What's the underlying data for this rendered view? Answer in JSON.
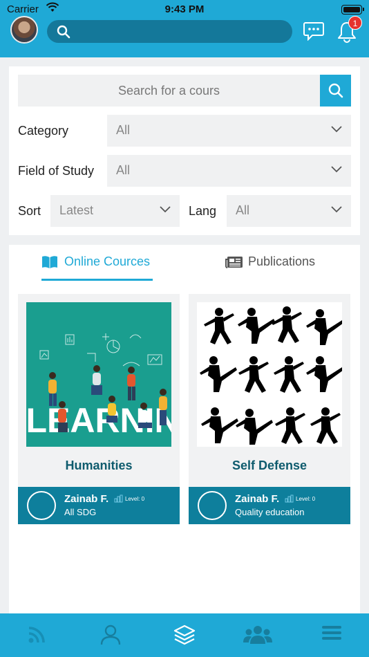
{
  "status_bar": {
    "carrier": "Carrier",
    "time": "9:43 PM"
  },
  "header": {
    "search_placeholder": "",
    "notification_count": "1"
  },
  "filters": {
    "course_search_placeholder": "Search for a cours",
    "category": {
      "label": "Category",
      "value": "All"
    },
    "field_of_study": {
      "label": "Field of Study",
      "value": "All"
    },
    "sort": {
      "label": "Sort",
      "value": "Latest"
    },
    "lang": {
      "label": "Lang",
      "value": "All"
    }
  },
  "tabs": [
    {
      "label": "Online Cources",
      "active": true,
      "icon": "book-icon"
    },
    {
      "label": "Publications",
      "active": false,
      "icon": "newspaper-icon"
    }
  ],
  "courses": [
    {
      "title": "Humanities",
      "image_icon": "elearning-illustration",
      "image_text": "E-LEARNING",
      "author": "Zainab F.",
      "level": "Level: 0",
      "subtitle": "All SDG"
    },
    {
      "title": "Self Defense",
      "image_icon": "martial-arts-silhouettes",
      "author": "Zainab F.",
      "level": "Level: 0",
      "subtitle": "Quality education"
    }
  ],
  "bottom_nav": [
    {
      "name": "feed",
      "icon": "rss-icon"
    },
    {
      "name": "profile",
      "icon": "user-icon"
    },
    {
      "name": "courses",
      "icon": "layers-icon"
    },
    {
      "name": "groups",
      "icon": "users-icon"
    },
    {
      "name": "menu",
      "icon": "menu-icon"
    }
  ],
  "colors": {
    "primary": "#1fa9d6",
    "dark_teal": "#0e7f9c",
    "title": "#0e5b6d",
    "badge": "#e5322d"
  }
}
